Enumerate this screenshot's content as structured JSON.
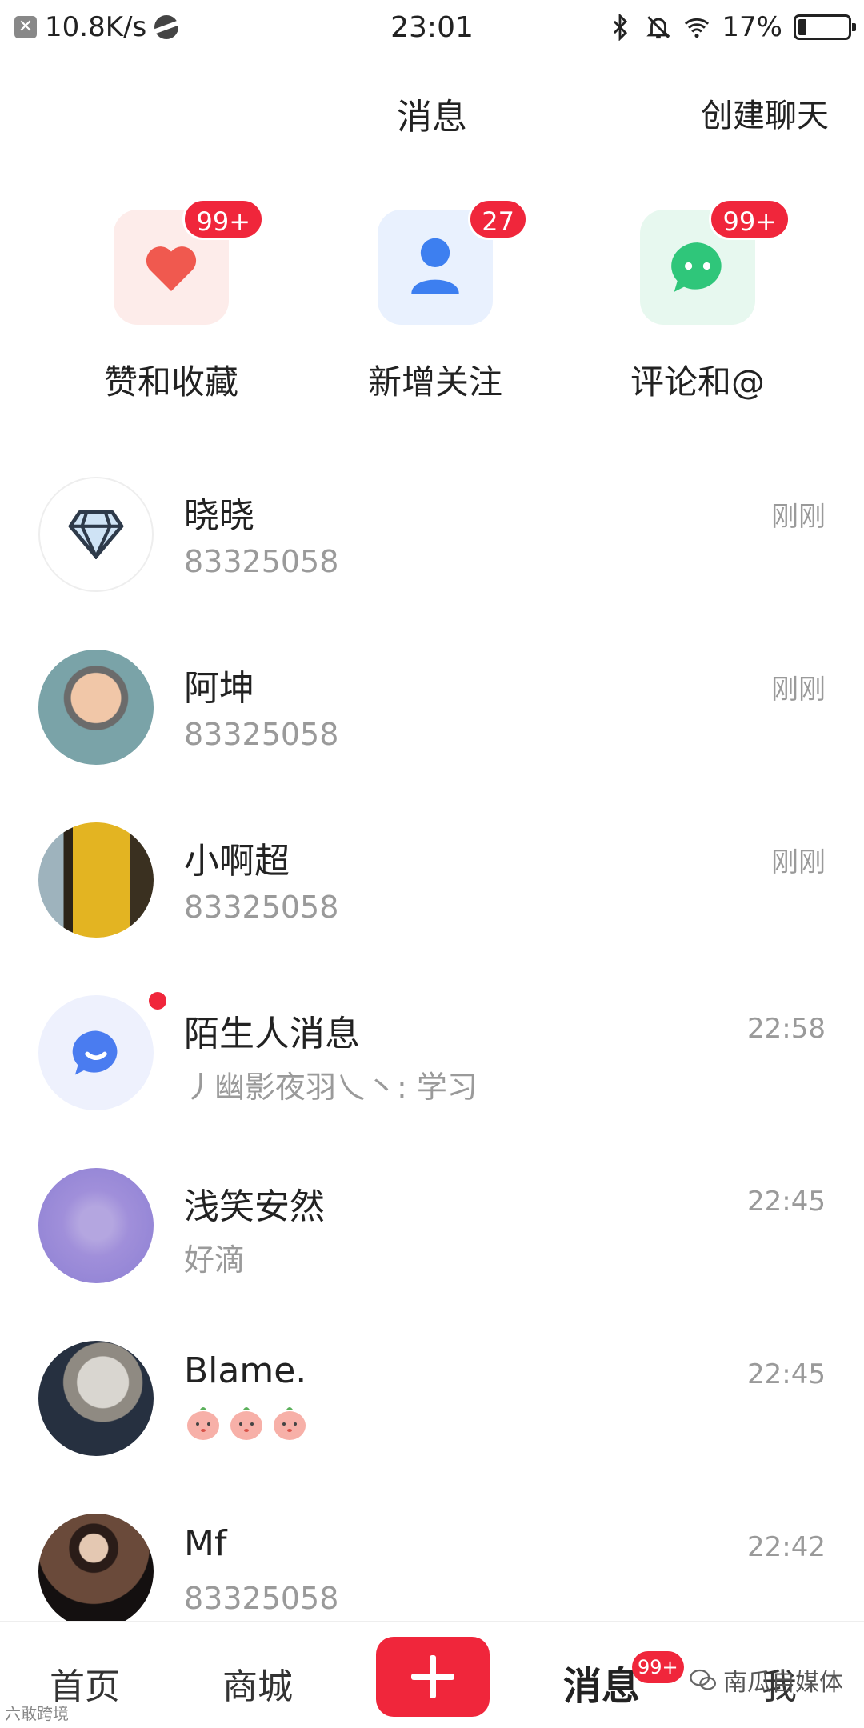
{
  "status_bar": {
    "speed": "10.8K/s",
    "time": "23:01",
    "battery": "17%"
  },
  "header": {
    "title": "消息",
    "action": "创建聊天"
  },
  "quick_actions": [
    {
      "label": "赞和收藏",
      "badge": "99+",
      "icon": "heart-icon",
      "color": "#f0594f"
    },
    {
      "label": "新增关注",
      "badge": "27",
      "icon": "person-icon",
      "color": "#3d7ff0"
    },
    {
      "label": "评论和@",
      "badge": "99+",
      "icon": "chat-bubble-icon",
      "color": "#2fc67a"
    }
  ],
  "messages": [
    {
      "name": "晓晓",
      "preview": "83325058",
      "time": "刚刚",
      "avatar": "diamond-icon"
    },
    {
      "name": "阿坤",
      "preview": "83325058",
      "time": "刚刚",
      "avatar": "photo"
    },
    {
      "name": "小啊超",
      "preview": "83325058",
      "time": "刚刚",
      "avatar": "photo"
    },
    {
      "name": "陌生人消息",
      "preview": "丿幽影夜羽乀丶: 学习",
      "time": "22:58",
      "avatar": "stranger-chat-icon",
      "unread": true
    },
    {
      "name": "浅笑安然",
      "preview": "好滴",
      "time": "22:45",
      "avatar": "photo"
    },
    {
      "name": "Blame.",
      "preview": "",
      "time": "22:45",
      "avatar": "photo",
      "stickers": 3
    },
    {
      "name": "Mf",
      "preview": "83325058",
      "time": "22:42",
      "avatar": "photo"
    }
  ],
  "tabbar": {
    "home": "首页",
    "mall": "商城",
    "messages": "消息",
    "messages_badge": "99+",
    "me": "我"
  },
  "watermark": {
    "right": "南瓜自媒体",
    "left": "六敢跨境"
  },
  "colors": {
    "accent": "#f0263b",
    "secondary_text": "#9a9a9a"
  }
}
